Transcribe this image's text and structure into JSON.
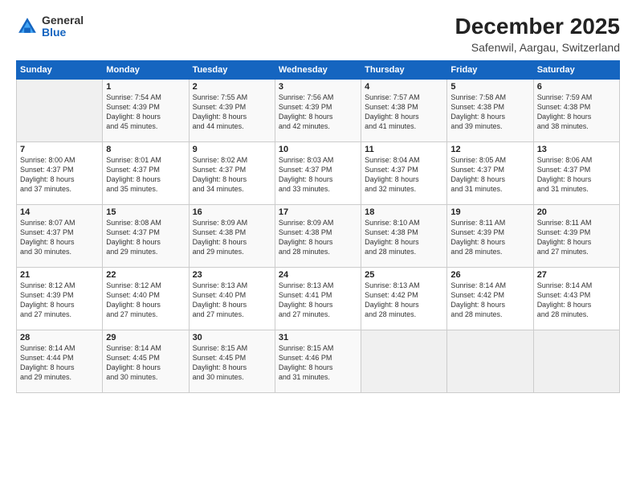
{
  "header": {
    "logo_general": "General",
    "logo_blue": "Blue",
    "month_title": "December 2025",
    "location": "Safenwil, Aargau, Switzerland"
  },
  "weekdays": [
    "Sunday",
    "Monday",
    "Tuesday",
    "Wednesday",
    "Thursday",
    "Friday",
    "Saturday"
  ],
  "weeks": [
    [
      {
        "day": "",
        "info": ""
      },
      {
        "day": "1",
        "info": "Sunrise: 7:54 AM\nSunset: 4:39 PM\nDaylight: 8 hours\nand 45 minutes."
      },
      {
        "day": "2",
        "info": "Sunrise: 7:55 AM\nSunset: 4:39 PM\nDaylight: 8 hours\nand 44 minutes."
      },
      {
        "day": "3",
        "info": "Sunrise: 7:56 AM\nSunset: 4:39 PM\nDaylight: 8 hours\nand 42 minutes."
      },
      {
        "day": "4",
        "info": "Sunrise: 7:57 AM\nSunset: 4:38 PM\nDaylight: 8 hours\nand 41 minutes."
      },
      {
        "day": "5",
        "info": "Sunrise: 7:58 AM\nSunset: 4:38 PM\nDaylight: 8 hours\nand 39 minutes."
      },
      {
        "day": "6",
        "info": "Sunrise: 7:59 AM\nSunset: 4:38 PM\nDaylight: 8 hours\nand 38 minutes."
      }
    ],
    [
      {
        "day": "7",
        "info": "Sunrise: 8:00 AM\nSunset: 4:37 PM\nDaylight: 8 hours\nand 37 minutes."
      },
      {
        "day": "8",
        "info": "Sunrise: 8:01 AM\nSunset: 4:37 PM\nDaylight: 8 hours\nand 35 minutes."
      },
      {
        "day": "9",
        "info": "Sunrise: 8:02 AM\nSunset: 4:37 PM\nDaylight: 8 hours\nand 34 minutes."
      },
      {
        "day": "10",
        "info": "Sunrise: 8:03 AM\nSunset: 4:37 PM\nDaylight: 8 hours\nand 33 minutes."
      },
      {
        "day": "11",
        "info": "Sunrise: 8:04 AM\nSunset: 4:37 PM\nDaylight: 8 hours\nand 32 minutes."
      },
      {
        "day": "12",
        "info": "Sunrise: 8:05 AM\nSunset: 4:37 PM\nDaylight: 8 hours\nand 31 minutes."
      },
      {
        "day": "13",
        "info": "Sunrise: 8:06 AM\nSunset: 4:37 PM\nDaylight: 8 hours\nand 31 minutes."
      }
    ],
    [
      {
        "day": "14",
        "info": "Sunrise: 8:07 AM\nSunset: 4:37 PM\nDaylight: 8 hours\nand 30 minutes."
      },
      {
        "day": "15",
        "info": "Sunrise: 8:08 AM\nSunset: 4:37 PM\nDaylight: 8 hours\nand 29 minutes."
      },
      {
        "day": "16",
        "info": "Sunrise: 8:09 AM\nSunset: 4:38 PM\nDaylight: 8 hours\nand 29 minutes."
      },
      {
        "day": "17",
        "info": "Sunrise: 8:09 AM\nSunset: 4:38 PM\nDaylight: 8 hours\nand 28 minutes."
      },
      {
        "day": "18",
        "info": "Sunrise: 8:10 AM\nSunset: 4:38 PM\nDaylight: 8 hours\nand 28 minutes."
      },
      {
        "day": "19",
        "info": "Sunrise: 8:11 AM\nSunset: 4:39 PM\nDaylight: 8 hours\nand 28 minutes."
      },
      {
        "day": "20",
        "info": "Sunrise: 8:11 AM\nSunset: 4:39 PM\nDaylight: 8 hours\nand 27 minutes."
      }
    ],
    [
      {
        "day": "21",
        "info": "Sunrise: 8:12 AM\nSunset: 4:39 PM\nDaylight: 8 hours\nand 27 minutes."
      },
      {
        "day": "22",
        "info": "Sunrise: 8:12 AM\nSunset: 4:40 PM\nDaylight: 8 hours\nand 27 minutes."
      },
      {
        "day": "23",
        "info": "Sunrise: 8:13 AM\nSunset: 4:40 PM\nDaylight: 8 hours\nand 27 minutes."
      },
      {
        "day": "24",
        "info": "Sunrise: 8:13 AM\nSunset: 4:41 PM\nDaylight: 8 hours\nand 27 minutes."
      },
      {
        "day": "25",
        "info": "Sunrise: 8:13 AM\nSunset: 4:42 PM\nDaylight: 8 hours\nand 28 minutes."
      },
      {
        "day": "26",
        "info": "Sunrise: 8:14 AM\nSunset: 4:42 PM\nDaylight: 8 hours\nand 28 minutes."
      },
      {
        "day": "27",
        "info": "Sunrise: 8:14 AM\nSunset: 4:43 PM\nDaylight: 8 hours\nand 28 minutes."
      }
    ],
    [
      {
        "day": "28",
        "info": "Sunrise: 8:14 AM\nSunset: 4:44 PM\nDaylight: 8 hours\nand 29 minutes."
      },
      {
        "day": "29",
        "info": "Sunrise: 8:14 AM\nSunset: 4:45 PM\nDaylight: 8 hours\nand 30 minutes."
      },
      {
        "day": "30",
        "info": "Sunrise: 8:15 AM\nSunset: 4:45 PM\nDaylight: 8 hours\nand 30 minutes."
      },
      {
        "day": "31",
        "info": "Sunrise: 8:15 AM\nSunset: 4:46 PM\nDaylight: 8 hours\nand 31 minutes."
      },
      {
        "day": "",
        "info": ""
      },
      {
        "day": "",
        "info": ""
      },
      {
        "day": "",
        "info": ""
      }
    ]
  ]
}
